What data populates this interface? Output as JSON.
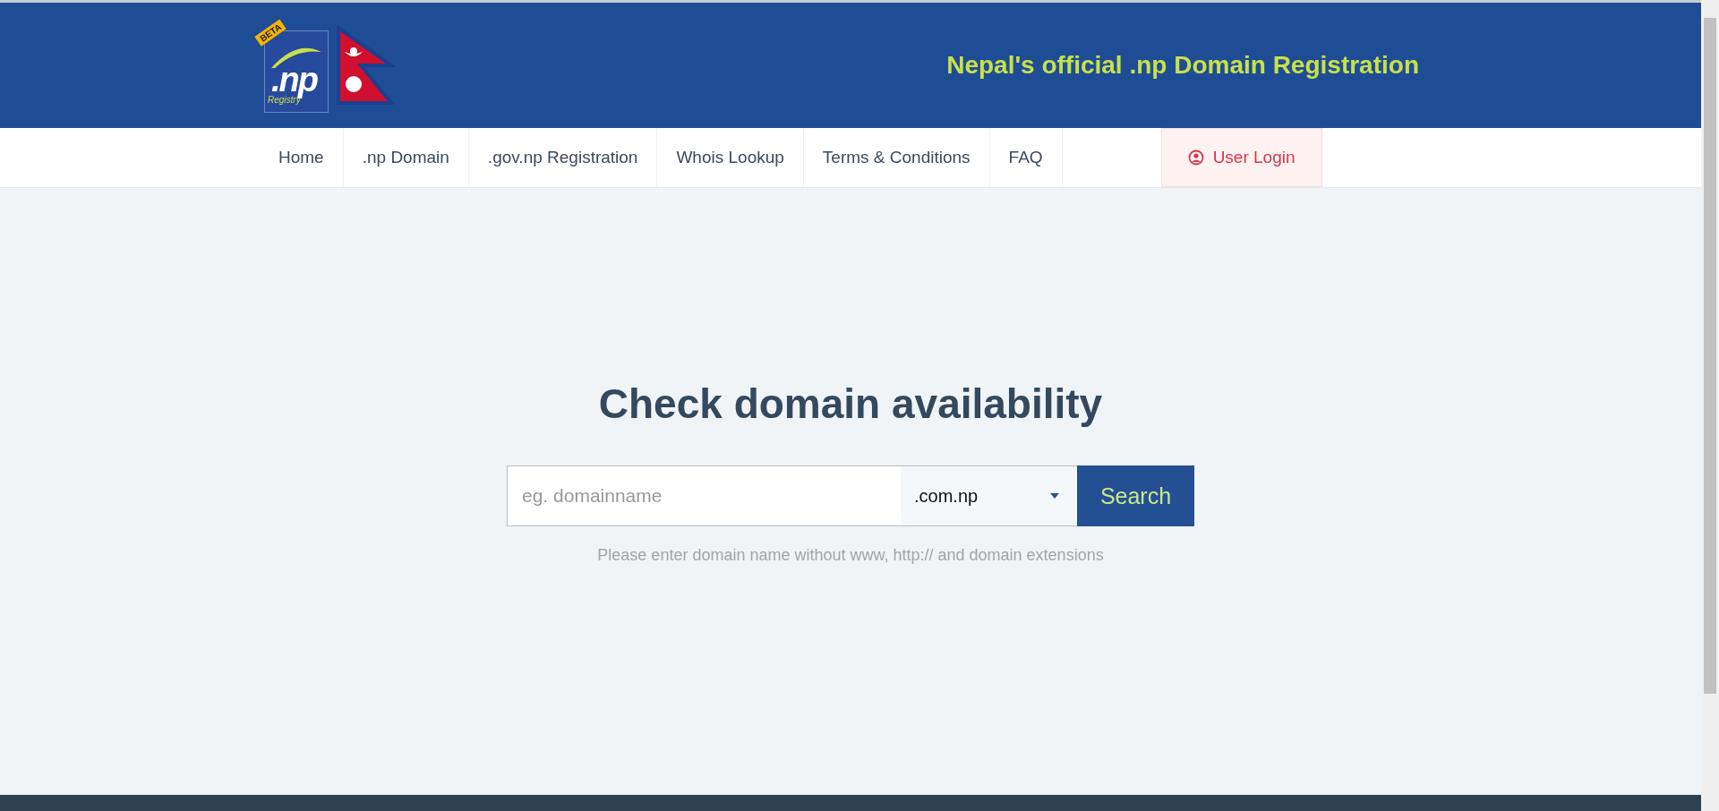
{
  "header": {
    "logo": {
      "badge": "BETA",
      "mark": ".np",
      "caption": "Registry"
    },
    "tagline": "Nepal's official .np Domain Registration"
  },
  "nav": {
    "items": [
      {
        "label": "Home"
      },
      {
        "label": ".np Domain"
      },
      {
        "label": ".gov.np Registration"
      },
      {
        "label": "Whois Lookup"
      },
      {
        "label": "Terms & Conditions"
      },
      {
        "label": "FAQ"
      }
    ],
    "login": "User Login"
  },
  "search": {
    "title": "Check domain availability",
    "placeholder": "eg. domainname",
    "extension": ".com.np",
    "button": "Search",
    "hint": "Please enter domain name without www, http:// and domain extensions"
  }
}
